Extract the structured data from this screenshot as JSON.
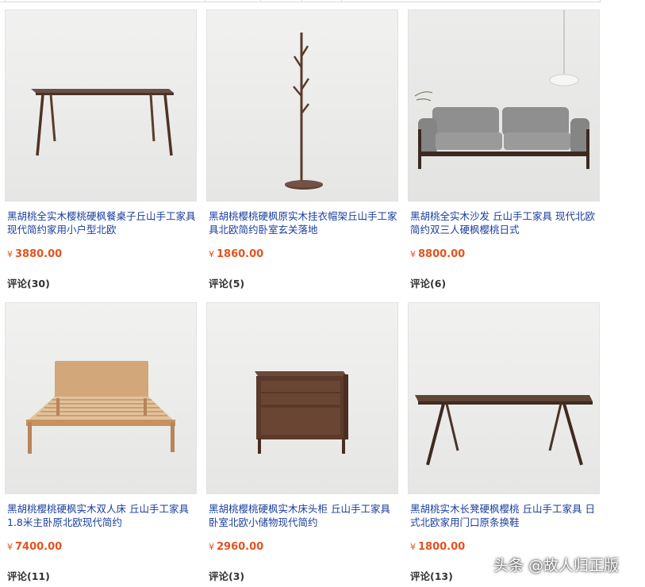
{
  "currency_symbol": "¥",
  "colors": {
    "title_link": "#1a3e9e",
    "price": "#e4531f"
  },
  "products": [
    {
      "title": "黑胡桃全实木樱桃硬枫餐桌子丘山手工家具现代简约家用小户型北欧",
      "price": "3880.00",
      "reviews": "评论(30)",
      "image_icon": "dining-table-icon"
    },
    {
      "title": "黑胡桃樱桃硬枫原实木挂衣帽架丘山手工家具北欧简约卧室玄关落地",
      "price": "1860.00",
      "reviews": "评论(5)",
      "image_icon": "coat-rack-icon"
    },
    {
      "title": "黑胡桃全实木沙发 丘山手工家具 现代北欧简约双三人硬枫樱桃日式",
      "price": "8800.00",
      "reviews": "评论(6)",
      "image_icon": "sofa-icon"
    },
    {
      "title": "黑胡桃樱桃硬枫实木双人床 丘山手工家具1.8米主卧原北欧现代简约",
      "price": "7400.00",
      "reviews": "评论(11)",
      "image_icon": "bed-icon"
    },
    {
      "title": "黑胡桃樱桃硬枫实木床头柜 丘山手工家具卧室北欧小储物现代简约",
      "price": "2960.00",
      "reviews": "评论(3)",
      "image_icon": "nightstand-icon"
    },
    {
      "title": "黑胡桃实木长凳硬枫樱桃 丘山手工家具 日式北欧家用门口原条换鞋",
      "price": "1800.00",
      "reviews": "评论(13)",
      "image_icon": "bench-icon"
    }
  ],
  "watermark": "头条 @故人归正版"
}
